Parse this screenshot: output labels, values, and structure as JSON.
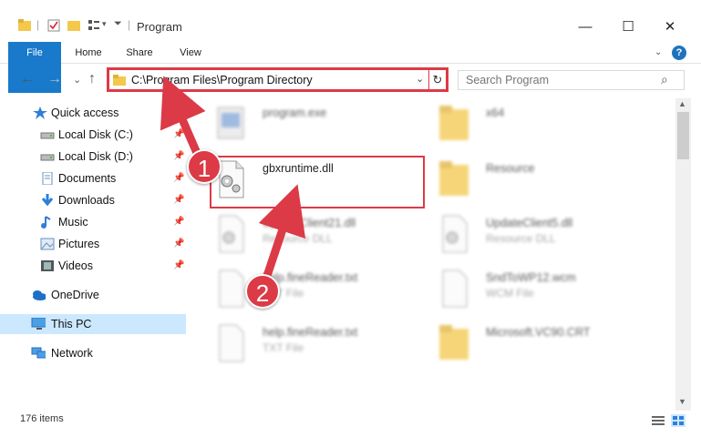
{
  "window": {
    "title": "Program",
    "controls": {
      "minimize": "—",
      "maximize": "☐",
      "close": "✕"
    }
  },
  "ribbon": {
    "tabs": [
      "File",
      "Home",
      "Share",
      "View"
    ],
    "help": "?",
    "collapse": "⌄"
  },
  "nav": {
    "back": "←",
    "forward": "→",
    "recent": "⌄",
    "up": "↑",
    "address": "C:\\Program Files\\Program Directory",
    "address_dropdown": "⌄",
    "refresh": "↻",
    "search_placeholder": "Search Program"
  },
  "sidebar": {
    "items": [
      {
        "label": "Quick access",
        "icon": "star-icon"
      },
      {
        "label": "Local Disk (C:)",
        "icon": "drive-icon",
        "pinned": true
      },
      {
        "label": "Local Disk (D:)",
        "icon": "drive-icon",
        "pinned": true
      },
      {
        "label": "Documents",
        "icon": "documents-icon",
        "pinned": true
      },
      {
        "label": "Downloads",
        "icon": "downloads-icon",
        "pinned": true
      },
      {
        "label": "Music",
        "icon": "music-icon",
        "pinned": true
      },
      {
        "label": "Pictures",
        "icon": "pictures-icon",
        "pinned": true
      },
      {
        "label": "Videos",
        "icon": "videos-icon",
        "pinned": true
      },
      {
        "label": "OneDrive",
        "icon": "onedrive-icon"
      },
      {
        "label": "This PC",
        "icon": "computer-icon",
        "selected": true
      },
      {
        "label": "Network",
        "icon": "network-icon"
      }
    ],
    "pin_glyph": "📌"
  },
  "files": [
    {
      "name": "program.exe",
      "type": "",
      "icon": "exe-icon",
      "blurred": true
    },
    {
      "name": "x64",
      "type": "",
      "icon": "folder-icon",
      "blurred": true
    },
    {
      "name": "gbxruntime.dll",
      "type": "",
      "icon": "dll-icon",
      "blurred": false
    },
    {
      "name": "Resource",
      "type": "",
      "icon": "folder-icon",
      "blurred": true
    },
    {
      "name": "UpdateClient21.dll",
      "type": "Resource DLL",
      "icon": "dll-icon",
      "blurred": true
    },
    {
      "name": "UpdateClient5.dll",
      "type": "Resource DLL",
      "icon": "dll-icon",
      "blurred": true
    },
    {
      "name": "help.fineReader.txt",
      "type": "TXT File",
      "icon": "text-file-icon",
      "blurred": true
    },
    {
      "name": "SndToWP12.wcm",
      "type": "WCM File",
      "icon": "generic-file-icon",
      "blurred": true
    },
    {
      "name": "help.fineReader.txt",
      "type": "TXT File",
      "icon": "text-file-icon",
      "blurred": true
    },
    {
      "name": "Microsoft.VC90.CRT",
      "type": "",
      "icon": "folder-icon",
      "blurred": true
    }
  ],
  "status": {
    "count": "176 items"
  },
  "annotations": {
    "step1": "1",
    "step2": "2"
  },
  "colors": {
    "accent": "#1979ca",
    "highlight": "#dc3a46",
    "selected": "#cce8ff"
  }
}
